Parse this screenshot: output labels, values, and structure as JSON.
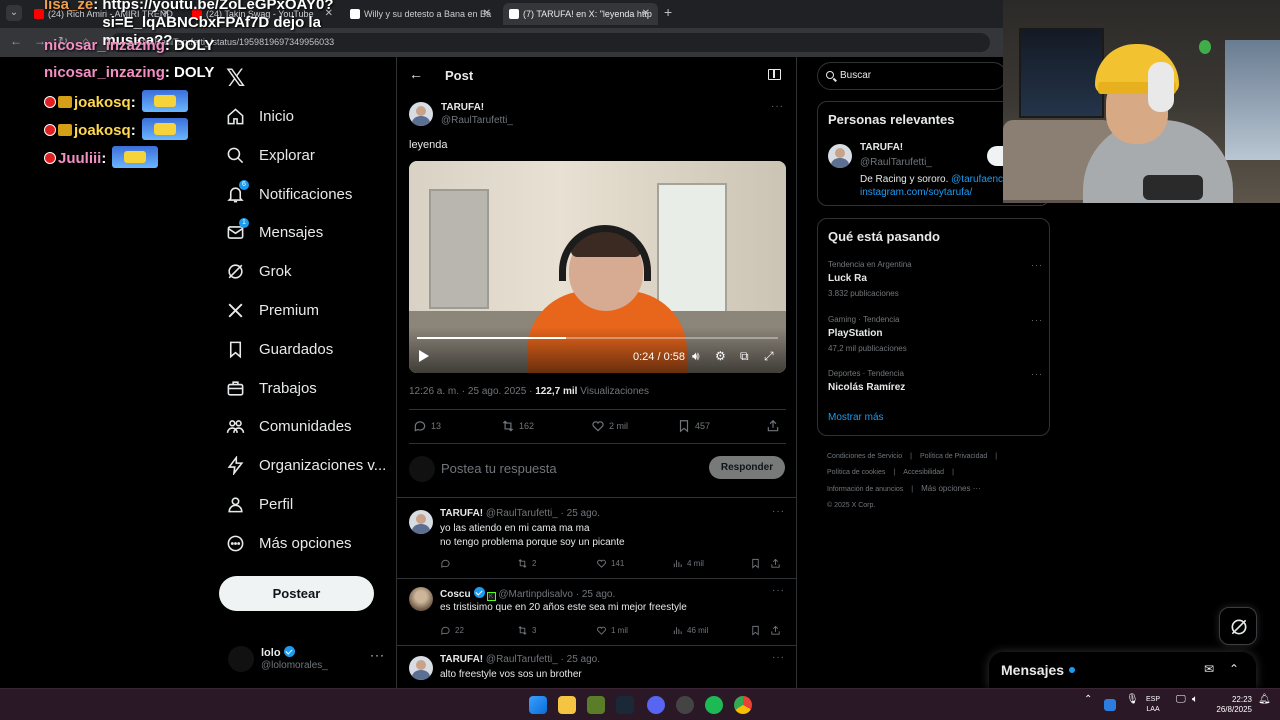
{
  "browser": {
    "tabs": [
      {
        "title": "(24) Rich Amiri - AMIRI TREND",
        "color": "#ff0000"
      },
      {
        "title": "(24) Takin Swag - YouTube",
        "color": "#ff0000"
      },
      {
        "title": "Willy y su detesto a Bana en Ba",
        "color": "#ffffff"
      },
      {
        "title": "(7) TARUFA! en X: \"leyenda http",
        "color": "#ffffff"
      }
    ],
    "url": "x.com/RaulTarufetti_/status/1959819697349956033"
  },
  "stream_chat": {
    "top_user": "lisa_ze",
    "top_text": "https://youtu.be/ZoLeGPxOAY0?si=E_lqABNCbxFPAf7D dejo la musica??",
    "messages": [
      {
        "user": "nicosar_inzazing",
        "text": "DOLY"
      },
      {
        "user": "joakosq",
        "text": ""
      },
      {
        "user": "joakosq",
        "text": ""
      },
      {
        "user": "Juuliii",
        "text": ""
      }
    ]
  },
  "nav": {
    "items": [
      {
        "label": "Inicio",
        "icon": "home-icon"
      },
      {
        "label": "Explorar",
        "icon": "search-icon"
      },
      {
        "label": "Notificaciones",
        "icon": "bell-icon",
        "badge": "6"
      },
      {
        "label": "Mensajes",
        "icon": "mail-icon",
        "badge": "1"
      },
      {
        "label": "Grok",
        "icon": "grok-icon"
      },
      {
        "label": "Premium",
        "icon": "x-icon"
      },
      {
        "label": "Guardados",
        "icon": "bookmark-icon"
      },
      {
        "label": "Trabajos",
        "icon": "briefcase-icon"
      },
      {
        "label": "Comunidades",
        "icon": "people-icon"
      },
      {
        "label": "Organizaciones v...",
        "icon": "lightning-icon"
      },
      {
        "label": "Perfil",
        "icon": "person-icon"
      },
      {
        "label": "Más opciones",
        "icon": "more-circle-icon"
      }
    ],
    "post_button": "Postear",
    "profile": {
      "name": "lolo",
      "handle": "@lolomorales_"
    }
  },
  "post": {
    "header_title": "Post",
    "author_name": "TARUFA!",
    "author_handle": "@RaulTarufetti_",
    "text": "leyenda",
    "video": {
      "current": "0:24",
      "duration": "0:58",
      "progress": 0.414
    },
    "timestamp": "12:26 a. m. · 25 ago. 2025 ·",
    "views_count": "122,7 mil",
    "views_label": "Visualizaciones",
    "stats": {
      "replies": "13",
      "reposts": "162",
      "likes": "2 mil",
      "bookmarks": "457"
    },
    "reply_placeholder": "Postea tu respuesta",
    "reply_button": "Responder"
  },
  "replies": [
    {
      "name": "TARUFA!",
      "handle": "@RaulTarufetti_ · 25 ago.",
      "text": "yo las atiendo en mi cama ma ma\nno tengo problema porque soy un picante",
      "replies": "",
      "reposts": "2",
      "likes": "141",
      "views": "4 mil"
    },
    {
      "name": "Coscu",
      "handle": "@Martinpdisalvo · 25 ago.",
      "text": "es tristisimo que en 20 años este sea mi mejor freestyle",
      "replies": "22",
      "reposts": "3",
      "likes": "1 mil",
      "views": "46 mil"
    },
    {
      "name": "TARUFA!",
      "handle": "@RaulTarufetti_ · 25 ago.",
      "text": "alto freestyle vos sos un brother",
      "replies": "",
      "reposts": "",
      "likes": "",
      "views": ""
    }
  ],
  "sidebar": {
    "search_placeholder": "Buscar",
    "relevant_title": "Personas relevantes",
    "relevant": {
      "name": "TARUFA!",
      "handle": "@RaulTarufetti_",
      "bio": "De Racing y sororo.",
      "bio_link": "@tarufaenc",
      "bio_url": "instagram.com/soytarufa/",
      "follow": "S"
    },
    "trends_title": "Qué está pasando",
    "trends": [
      {
        "context": "Tendencia en Argentina",
        "title": "Luck Ra",
        "count": "3.832 publicaciones"
      },
      {
        "context": "Gaming · Tendencia",
        "title": "PlayStation",
        "count": "47,2 mil publicaciones"
      },
      {
        "context": "Deportes · Tendencia",
        "title": "Nicolás Ramírez",
        "count": ""
      }
    ],
    "show_more": "Mostrar más",
    "footer": [
      "Condiciones de Servicio",
      "|",
      "Política de Privacidad",
      "|",
      "Política de cookies",
      "|",
      "Accesibilidad",
      "|",
      "Información de anuncios",
      "|",
      "Más opciones ···",
      "© 2025 X Corp."
    ]
  },
  "messages_drawer": {
    "title": "Mensajes"
  },
  "taskbar": {
    "lang": "ESP",
    "lang_sub": "LAA",
    "time": "22:23",
    "date": "26/8/2025"
  },
  "colors": {
    "accent": "#1d9bf0",
    "text": "#e7e9ea",
    "muted": "#71767b",
    "border": "#2f3336"
  }
}
